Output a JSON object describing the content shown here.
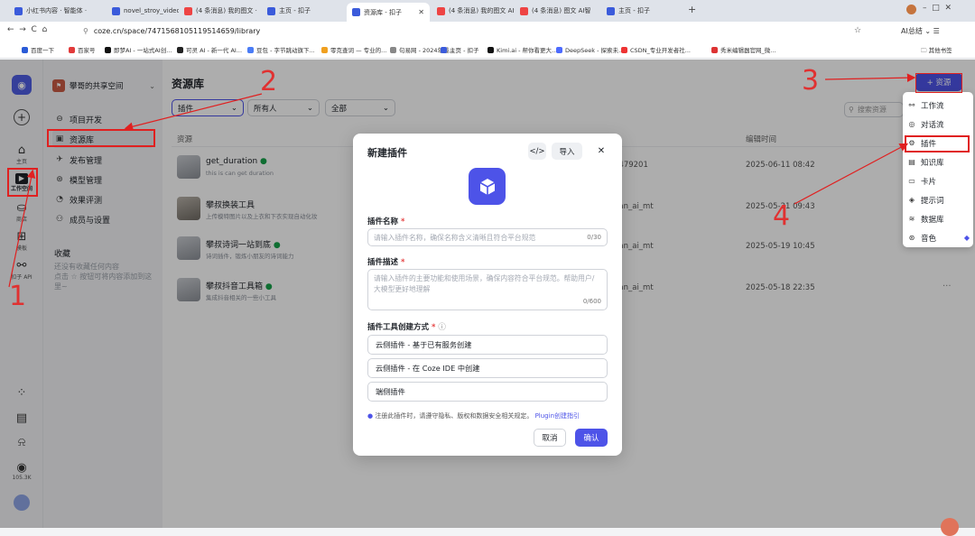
{
  "browser": {
    "tabs": [
      {
        "label": "小红书内容 · 智能体 ·"
      },
      {
        "label": "novel_stroy_video · "
      },
      {
        "label": "(4 条消息) 我的图文 ·"
      },
      {
        "label": "主页 - 扣子"
      },
      {
        "label": "资源库 - 扣子",
        "active": true
      },
      {
        "label": "(4 条消息) 我的图文 AI智"
      },
      {
        "label": "(4 条消息) 图文 AI智"
      },
      {
        "label": "主页 - 扣子"
      }
    ],
    "new_tab": "+",
    "url": "coze.cn/space/7471568105119514659/library",
    "ai_label": "AI总结",
    "bookmarks": [
      {
        "label": "百度一下",
        "color": "#2a5bd7"
      },
      {
        "label": "百家号",
        "color": "#e23a3a"
      },
      {
        "label": "即梦AI - 一站式AI创...",
        "color": "#111111"
      },
      {
        "label": "可灵 AI - 新一代 AI...",
        "color": "#222222"
      },
      {
        "label": "豆包 - 字节跳动旗下...",
        "color": "#4a7cf6"
      },
      {
        "label": "零克查词 — 专业的...",
        "color": "#f0a020"
      },
      {
        "label": "句易网 - 2024年最...",
        "color": "#888888"
      },
      {
        "label": "主页 - 扣子",
        "color": "#3b5bdb"
      },
      {
        "label": "Kimi.ai - 帮你看更大...",
        "color": "#111111"
      },
      {
        "label": "DeepSeek - 探索未...",
        "color": "#4d6bfe"
      },
      {
        "label": "CSDN_专业开发者社...",
        "color": "#e33"
      },
      {
        "label": "秀米编辑器官网_微...",
        "color": "#d33"
      }
    ],
    "bookmarks_folder": "其他书签"
  },
  "rail": {
    "items": [
      {
        "label": "主页",
        "icon": "home-icon"
      },
      {
        "label": "工作空间",
        "icon": "workspace-icon"
      },
      {
        "label": "商店",
        "icon": "store-icon"
      },
      {
        "label": "模板",
        "icon": "template-icon"
      },
      {
        "label": "扣子 API",
        "icon": "api-icon"
      }
    ],
    "credits": "105.3K"
  },
  "sidebar": {
    "space_name": "攀哥的共享空间",
    "items": [
      {
        "label": "项目开发"
      },
      {
        "label": "资源库"
      },
      {
        "label": "发布管理"
      },
      {
        "label": "模型管理"
      },
      {
        "label": "效果评测"
      },
      {
        "label": "成员与设置"
      }
    ],
    "favorites_title": "收藏",
    "favorites_hint": "还没有收藏任何内容\n点击 ☆ 按钮可将内容添加到这里~"
  },
  "main": {
    "title": "资源库",
    "filters": [
      "插件",
      "所有人",
      "全部"
    ],
    "add_button": "+ 资源",
    "search_placeholder": "搜索资源",
    "columns": {
      "resource": "资源",
      "edit_time": "编辑时间"
    },
    "rows": [
      {
        "name": "get_duration",
        "desc": "this is can get duration",
        "creator": "7479201",
        "time": "2025-06-11 08:42"
      },
      {
        "name": "攀叔换装工具",
        "desc": "上传模特图片以及上衣和下衣实现自动化妆",
        "creator": "uan_ai_mt",
        "time": "2025-05-21 09:43"
      },
      {
        "name": "攀叔诗词一站到底",
        "desc": "诗词插件，锻炼小朋友的诗词能力",
        "creator": "uan_ai_mt",
        "time": "2025-05-19 10:45"
      },
      {
        "name": "攀叔抖音工具箱",
        "desc": "集成抖音相关的一些小工具",
        "creator": "uan_ai_mt",
        "time": "2025-05-18 22:35"
      }
    ]
  },
  "dropdown": {
    "items": [
      {
        "label": "工作流",
        "icon": "workflow-icon"
      },
      {
        "label": "对话流",
        "icon": "chatflow-icon"
      },
      {
        "label": "插件",
        "icon": "plugin-icon"
      },
      {
        "label": "知识库",
        "icon": "knowledge-icon"
      },
      {
        "label": "卡片",
        "icon": "card-icon"
      },
      {
        "label": "提示词",
        "icon": "prompt-icon"
      },
      {
        "label": "数据库",
        "icon": "database-icon"
      },
      {
        "label": "音色",
        "icon": "voice-icon"
      }
    ]
  },
  "modal": {
    "title": "新建插件",
    "code_button": "</>",
    "import_button": "导入",
    "close": "✕",
    "name_label": "插件名称",
    "name_placeholder": "请输入插件名称，确保名称含义清晰且符合平台规范",
    "name_count": "0/30",
    "desc_label": "插件描述",
    "desc_placeholder": "请输入插件的主要功能和使用场景，确保内容符合平台规范。帮助用户/大模型更好地理解",
    "desc_count": "0/600",
    "method_label": "插件工具创建方式",
    "options": [
      "云侧插件 - 基于已有服务创建",
      "云侧插件 - 在 Coze IDE 中创建",
      "端侧插件"
    ],
    "notice": "注册此插件时，请遵守隐私、版权和数据安全相关规定。",
    "notice_link": "Plugin创建指引",
    "cancel": "取消",
    "confirm": "确认",
    "accent": "#4d53e8"
  },
  "annotations": [
    "1",
    "2",
    "3",
    "4"
  ]
}
